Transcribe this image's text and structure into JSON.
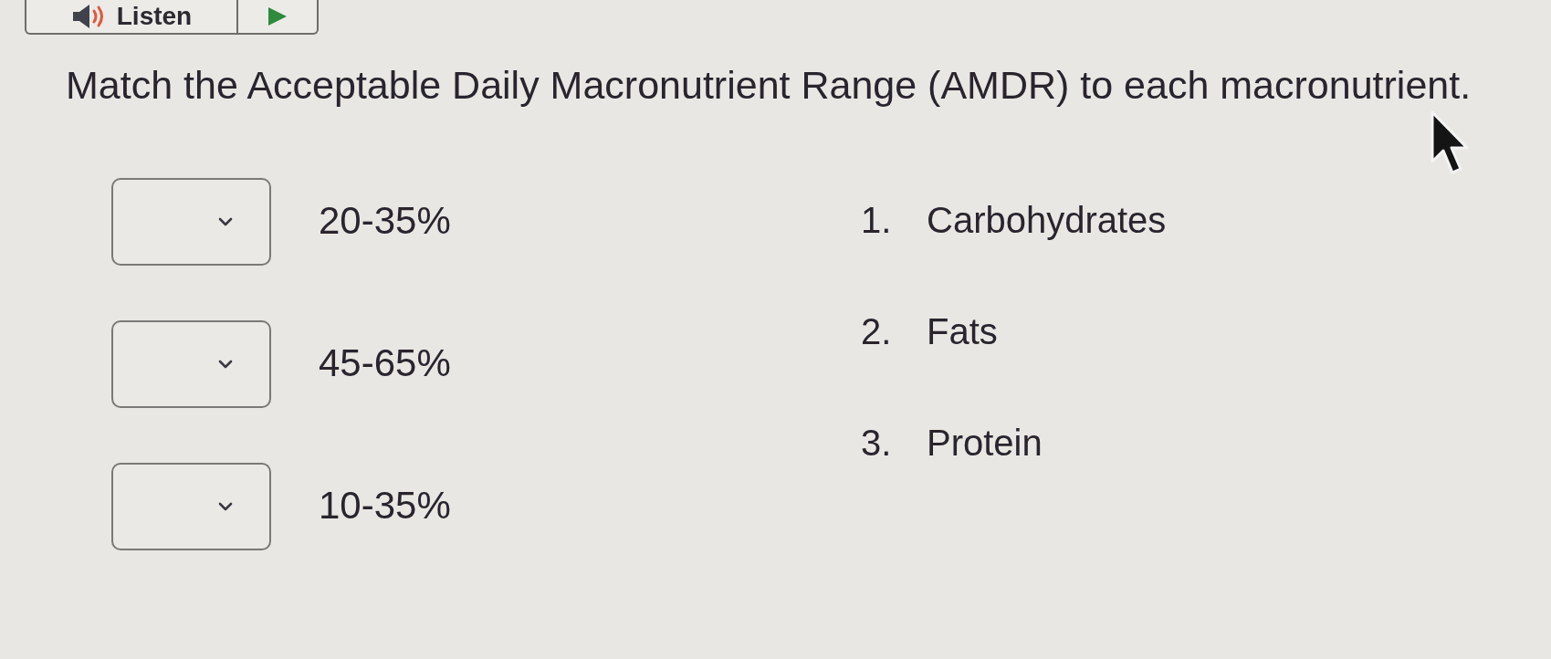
{
  "toolbar": {
    "listen_label": "Listen"
  },
  "instruction": "Match the Acceptable Daily Macronutrient Range (AMDR) to each macronutrient.",
  "matches": [
    {
      "range": "20-35%"
    },
    {
      "range": "45-65%"
    },
    {
      "range": "10-35%"
    }
  ],
  "answers": [
    {
      "number": "1.",
      "label": "Carbohydrates"
    },
    {
      "number": "2.",
      "label": "Fats"
    },
    {
      "number": "3.",
      "label": "Protein"
    }
  ]
}
